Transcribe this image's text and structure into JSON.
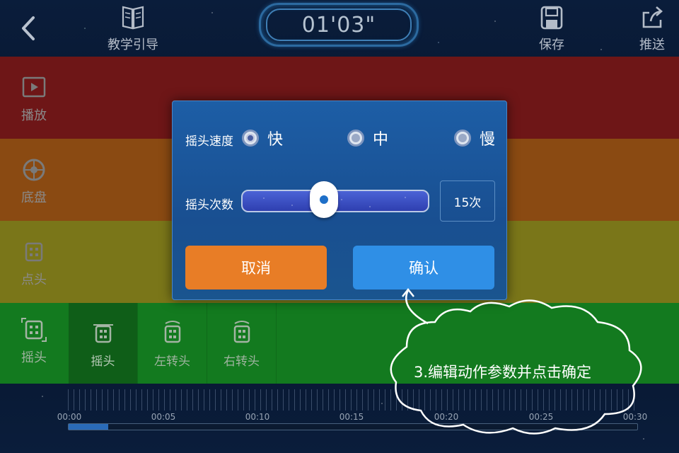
{
  "header": {
    "back_icon": "chevron-left-icon",
    "tutorial_label": "教学引导",
    "tutorial_icon": "book-icon",
    "timer": "01'03\"",
    "save_label": "保存",
    "save_icon": "save-icon",
    "push_label": "推送",
    "push_icon": "share-icon"
  },
  "categories": [
    {
      "label": "播放",
      "icon": "play-icon",
      "color": "#6e1617"
    },
    {
      "label": "底盘",
      "icon": "wheel-icon",
      "color": "#8a4a12"
    },
    {
      "label": "点头",
      "icon": "robot-head-icon",
      "color": "#7a7619"
    },
    {
      "label": "摇头",
      "icon": "robot-head-icon",
      "color": "#137a1f"
    }
  ],
  "actions": [
    {
      "label": "摇头"
    },
    {
      "label": "左转头"
    },
    {
      "label": "右转头"
    }
  ],
  "timeline": {
    "ticks": [
      "00:00",
      "00:05",
      "00:10",
      "00:15",
      "00:20",
      "00:25",
      "00:30"
    ],
    "progress_fraction": 0.07
  },
  "dialog": {
    "speed_label": "摇头速度",
    "speed_options": [
      "快",
      "中",
      "慢"
    ],
    "speed_selected": "快",
    "count_label": "摇头次数",
    "count_slider_fraction": 0.44,
    "count_value": "15次",
    "cancel_label": "取消",
    "confirm_label": "确认"
  },
  "hint": {
    "text": "3.编辑动作参数并点击确定"
  },
  "colors": {
    "dialog_bg": "#1d5ea6",
    "cancel": "#e87d26",
    "confirm": "#2f8fe6"
  }
}
